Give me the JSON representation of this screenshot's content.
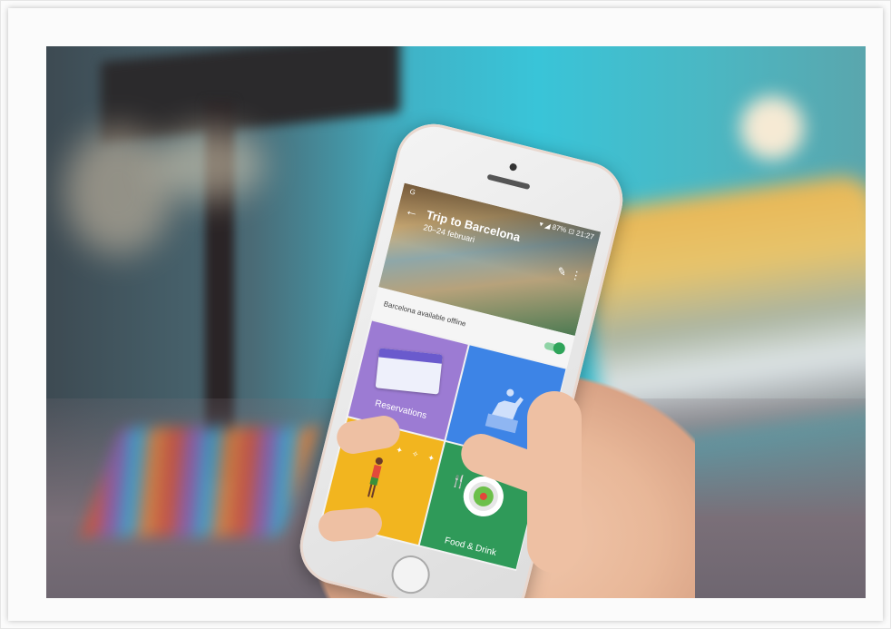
{
  "phone_screen": {
    "status_bar": {
      "left": "G",
      "right": "▾ ◢ 87% ⊡ 21:27"
    },
    "header": {
      "back_icon": "←",
      "title": "Trip to Barcelona",
      "subtitle": "20–24 februari",
      "edit_icon": "✎",
      "more_icon": "⋮"
    },
    "offline": {
      "label": "Barcelona available offline",
      "toggle_on": true
    },
    "tiles": {
      "reservations": {
        "label": "Reservations",
        "color": "#9c7bd3"
      },
      "sights": {
        "label": "",
        "color": "#3d84e6"
      },
      "activities": {
        "label": "",
        "color": "#f2b51f"
      },
      "food": {
        "label": "Food & Drink",
        "color": "#2f9a59"
      }
    }
  },
  "colors": {
    "accent_toggle": "#2fa45a",
    "sky": "#39c4d8"
  }
}
